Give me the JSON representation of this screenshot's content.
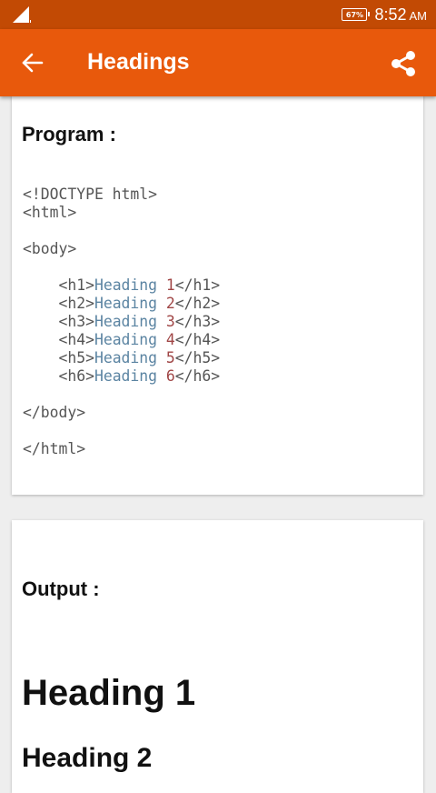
{
  "status_bar": {
    "battery": "67%",
    "time": "8:52",
    "ampm": "AM"
  },
  "app_bar": {
    "title": "Headings",
    "back_icon": "arrow-left-icon",
    "share_icon": "share-icon"
  },
  "program": {
    "title": "Program :",
    "code_lines": [
      "<!DOCTYPE html>",
      "<html>",
      "",
      "<body>",
      "",
      "    <h1>Heading 1</h1>",
      "    <h2>Heading 2</h2>",
      "    <h3>Heading 3</h3>",
      "    <h4>Heading 4</h4>",
      "    <h5>Heading 5</h5>",
      "    <h6>Heading 6</h6>",
      "",
      "</body>",
      "",
      "</html>"
    ]
  },
  "output": {
    "title": "Output :",
    "heading1": "Heading 1",
    "heading2": "Heading 2"
  },
  "colors": {
    "status_bar": "#c24a04",
    "app_bar": "#e8590c",
    "code_text": "#5b84a2",
    "code_number": "#a04646"
  }
}
